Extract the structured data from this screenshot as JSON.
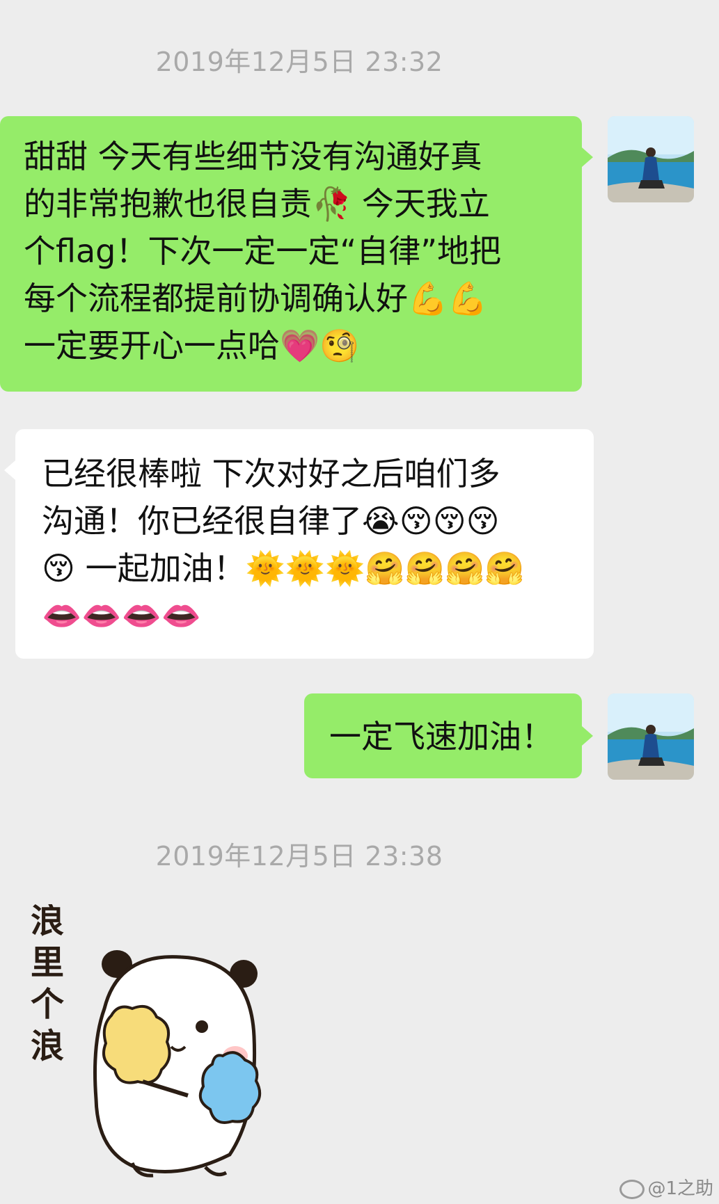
{
  "timestamps": {
    "first": "2019年12月5日 23:32",
    "second": "2019年12月5日 23:38"
  },
  "messages": [
    {
      "side": "sent",
      "lines": [
        "甜甜 今天有些细节没有沟通好真",
        "的非常抱歉也很自责🥀 今天我立",
        "个flag！下次一定一定“自律”地把",
        "每个流程都提前协调确认好💪💪",
        "一定要开心一点哈💗🧐"
      ]
    },
    {
      "side": "received",
      "lines": [
        "已经很棒啦 下次对好之后咱们多",
        "沟通！你已经很自律了😭😚😚😚",
        "😚 一起加油！🌞🌞🌞🤗🤗🤗🤗",
        "👄👄👄👄"
      ]
    },
    {
      "side": "sent",
      "lines": [
        "一定飞速加油！"
      ]
    }
  ],
  "sticker": {
    "caption": [
      "浪",
      "里",
      "个",
      "浪"
    ]
  },
  "watermark": "@1之助",
  "colors": {
    "background": "#ededed",
    "sent_bubble": "#95ec69",
    "received_bubble": "#ffffff",
    "timestamp": "#a9a9a9"
  }
}
